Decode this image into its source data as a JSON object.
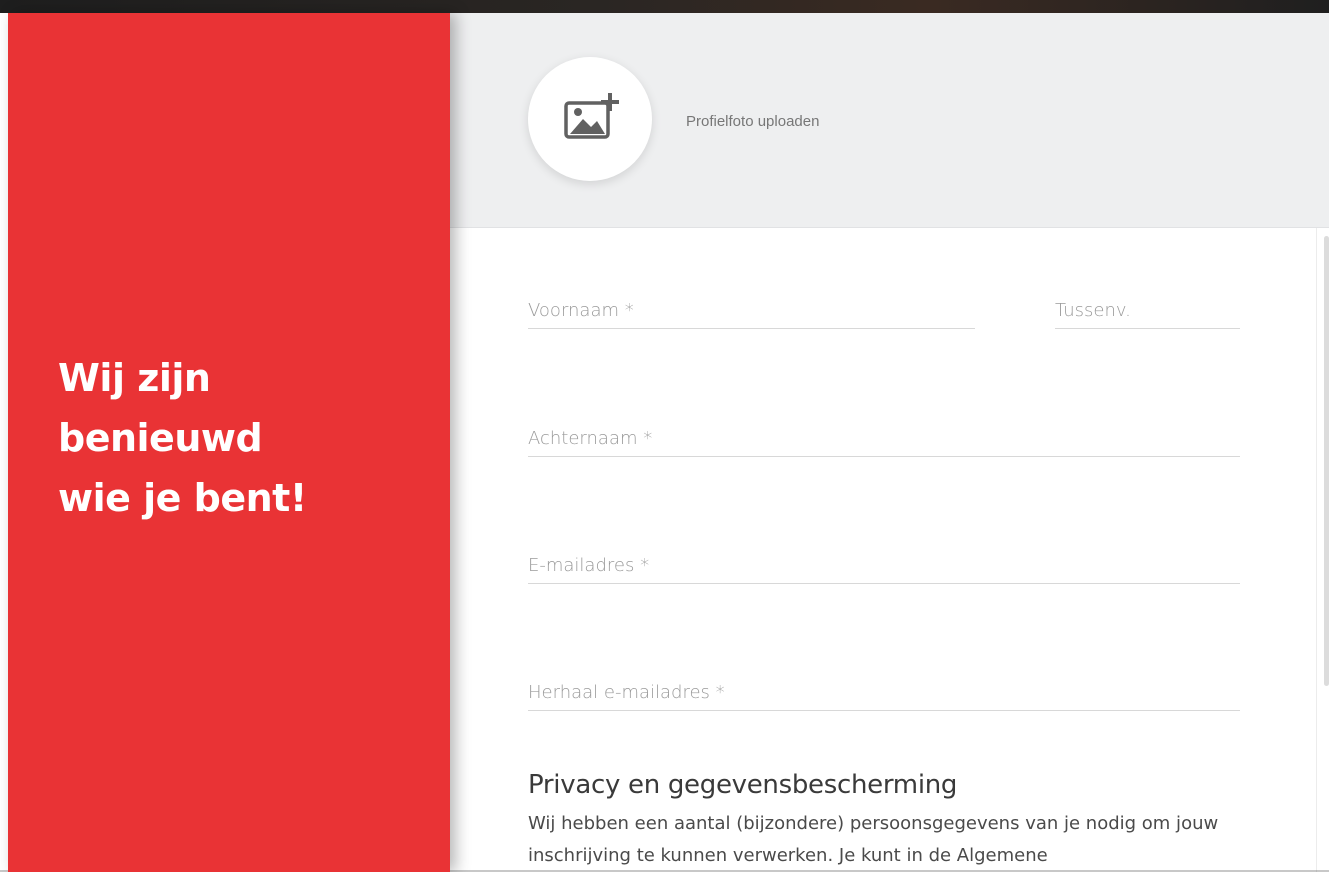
{
  "hero": {
    "line1": "Wij zijn",
    "line2": "benieuwd",
    "line3": "wie je bent!"
  },
  "photo_upload": {
    "label": "Profielfoto uploaden",
    "icon": "image-plus-icon"
  },
  "form": {
    "first_name_placeholder": "Voornaam *",
    "infix_placeholder": "Tussenv.",
    "last_name_placeholder": "Achternaam *",
    "email_placeholder": "E-mailadres *",
    "repeat_email_placeholder": "Herhaal e-mailadres *"
  },
  "privacy": {
    "title": "Privacy en gegevensbescherming",
    "text": "Wij hebben een aantal (bijzondere) persoonsgegevens van je nodig om jouw inschrijving te kunnen verwerken. Je kunt in de Algemene"
  },
  "colors": {
    "accent": "#e93335",
    "header_bg": "#eeeff0"
  }
}
